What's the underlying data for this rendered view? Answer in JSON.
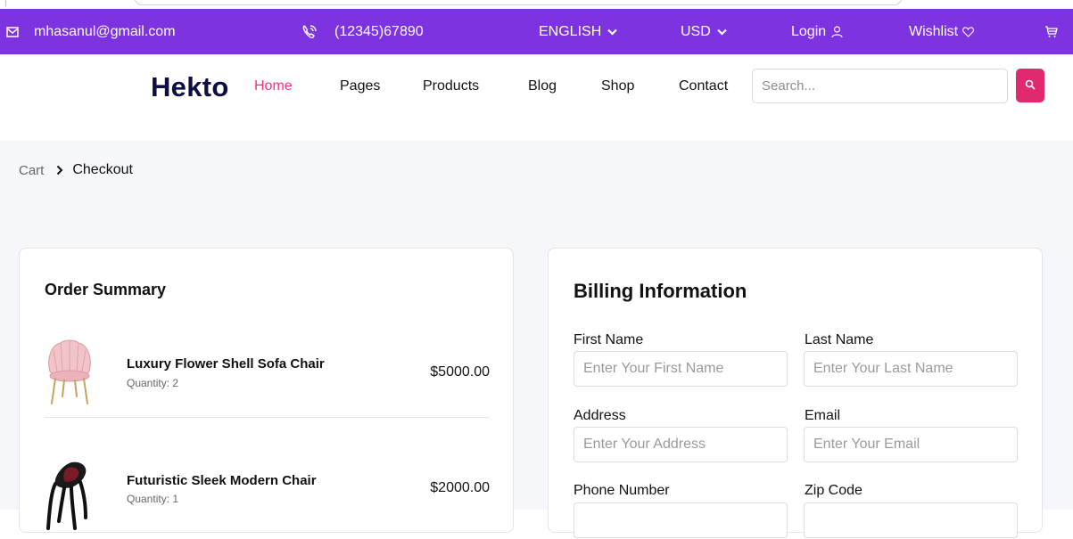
{
  "topbar": {
    "email": "mhasanul@gmail.com",
    "phone": "(12345)67890",
    "language": "ENGLISH",
    "currency": "USD",
    "login": "Login",
    "wishlist": "Wishlist"
  },
  "navbar": {
    "logo": "Hekto",
    "links": [
      "Home",
      "Pages",
      "Products",
      "Blog",
      "Shop",
      "Contact"
    ],
    "active_link": "Home",
    "search_placeholder": "Search..."
  },
  "breadcrumb": {
    "parent": "Cart",
    "current": "Checkout"
  },
  "order_summary": {
    "title": "Order Summary",
    "items": [
      {
        "name": "Luxury Flower Shell Sofa Chair",
        "quantity": "Quantity: 2",
        "price": "$5000.00",
        "image": "pink-shell-chair"
      },
      {
        "name": "Futuristic Sleek Modern Chair",
        "quantity": "Quantity: 1",
        "price": "$2000.00",
        "image": "black-red-modern-chair"
      }
    ]
  },
  "billing": {
    "title": "Billing Information",
    "fields": [
      {
        "label": "First Name",
        "placeholder": "Enter Your First Name"
      },
      {
        "label": "Last Name",
        "placeholder": "Enter Your Last Name"
      },
      {
        "label": "Address",
        "placeholder": "Enter Your Address"
      },
      {
        "label": "Email",
        "placeholder": "Enter Your Email"
      },
      {
        "label": "Phone Number",
        "placeholder": ""
      },
      {
        "label": "Zip Code",
        "placeholder": ""
      }
    ]
  },
  "colors": {
    "topbar_bg": "#7e33e0",
    "accent_pink": "#fb2e86",
    "search_button": "#e0296f",
    "logo": "#0d0e43",
    "page_bg": "#f6f7fb"
  }
}
